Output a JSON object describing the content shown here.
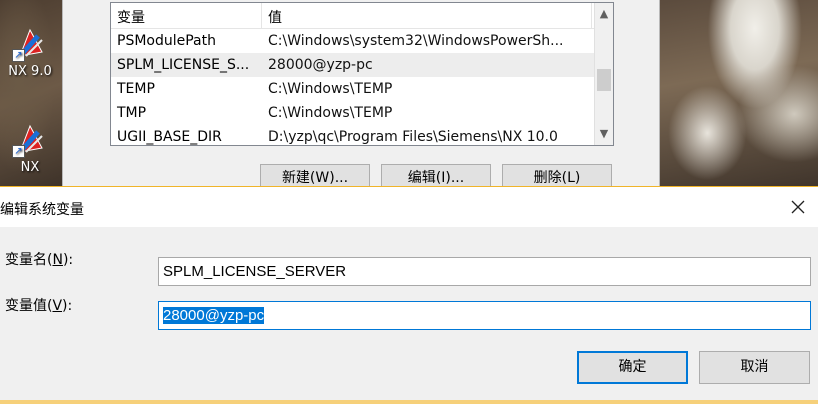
{
  "desktop": {
    "icons": [
      {
        "label": "NX 9.0",
        "icon": "nx-app-icon"
      },
      {
        "label": "NX",
        "icon": "nx-app-icon"
      }
    ]
  },
  "env_window": {
    "list": {
      "header": {
        "name": "变量",
        "value": "值"
      },
      "rows": [
        {
          "name": "PSModulePath",
          "value": "C:\\Windows\\system32\\WindowsPowerSh..."
        },
        {
          "name": "SPLM_LICENSE_S...",
          "value": "28000@yzp-pc"
        },
        {
          "name": "TEMP",
          "value": "C:\\Windows\\TEMP"
        },
        {
          "name": "TMP",
          "value": "C:\\Windows\\TEMP"
        },
        {
          "name": "UGII_BASE_DIR",
          "value": "D:\\yzp\\qc\\Program Files\\Siemens\\NX 10.0"
        }
      ]
    },
    "buttons": {
      "new": "新建(W)...",
      "edit": "编辑(I)...",
      "delete": "删除(L)"
    }
  },
  "dialog": {
    "title": "编辑系统变量",
    "name_label_prefix": "变量名(",
    "name_label_key": "N",
    "name_label_suffix": "):",
    "value_label_prefix": "变量值(",
    "value_label_key": "V",
    "value_label_suffix": "):",
    "name_value": "SPLM_LICENSE_SERVER",
    "value_value": "28000@yzp-pc",
    "ok_label": "确定",
    "cancel_label": "取消",
    "accent_color": "#0078d7"
  }
}
